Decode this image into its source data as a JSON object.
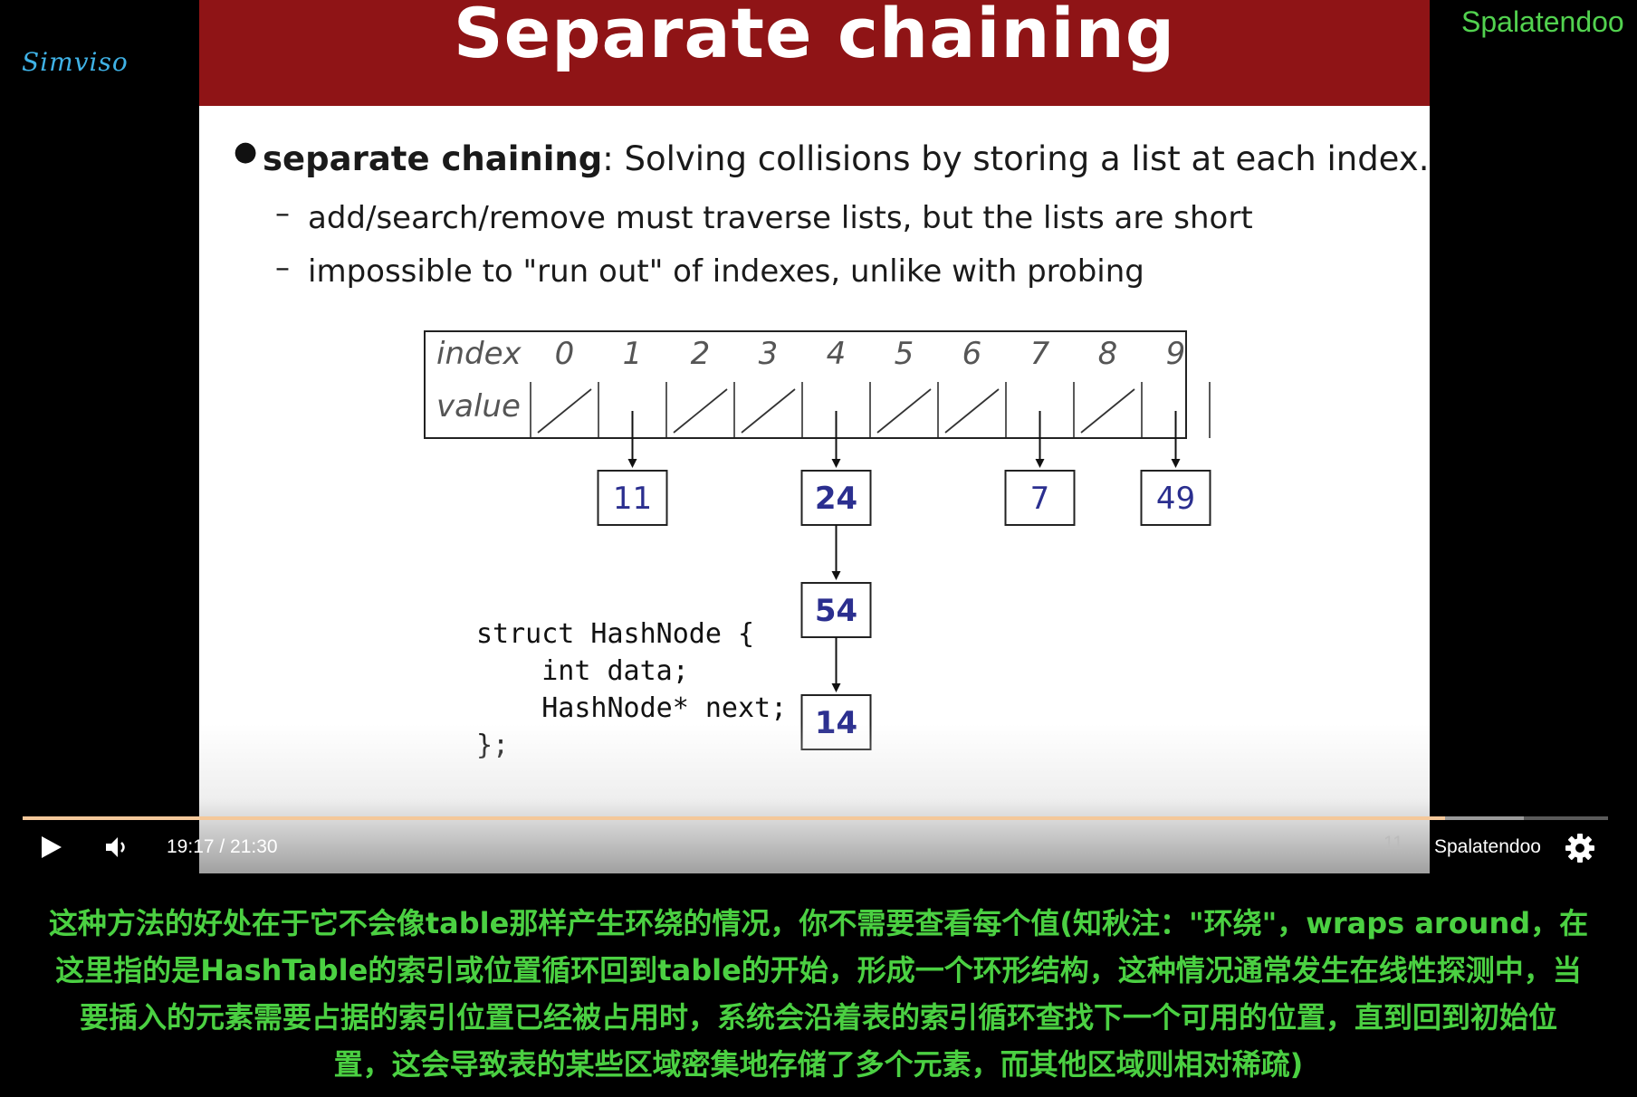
{
  "watermark_logo": "Simviso",
  "channel_top": "Spalatendoo",
  "slide": {
    "title": "Separate chaining",
    "bullet": {
      "term": "separate chaining",
      "rest": ": Solving collisions by storing a list at each index."
    },
    "subbullets": [
      "add/search/remove must traverse lists, but the lists are short",
      "impossible to \"run out\" of indexes, unlike with probing"
    ],
    "table": {
      "index_label": "index",
      "value_label": "value",
      "indexes": [
        "0",
        "1",
        "2",
        "3",
        "4",
        "5",
        "6",
        "7",
        "8",
        "9"
      ],
      "empty_slots": [
        0,
        2,
        3,
        5,
        6,
        8
      ]
    },
    "chains": [
      {
        "index": 1,
        "nodes": [
          "11"
        ]
      },
      {
        "index": 4,
        "nodes": [
          "24",
          "54",
          "14"
        ]
      },
      {
        "index": 7,
        "nodes": [
          "7"
        ]
      },
      {
        "index": 9,
        "nodes": [
          "49"
        ]
      }
    ],
    "code": "struct HashNode {\n    int data;\n    HashNode* next;\n};"
  },
  "player": {
    "time": "19:17 / 21:30",
    "progress_fraction": 0.897,
    "buffered_fraction": 0.947,
    "page_number": "11",
    "channel_name": "Spalatendoo",
    "icons": [
      "play-icon",
      "volume-icon",
      "settings-gear-icon"
    ],
    "accent_color": "#f4c89a"
  },
  "subtitles": [
    "这种方法的好处在于它不会像table那样产生环绕的情况，你不需要查看每个值(知秋注：\"环绕\"，wraps around，在",
    "这里指的是HashTable的索引或位置循环回到table的开始，形成一个环形结构，这种情况通常发生在线性探测中，当",
    "要插入的元素需要占据的索引位置已经被占用时，系统会沿着表的索引循环查找下一个可用的位置，直到回到初始位",
    "置，这会导致表的某些区域密集地存储了多个元素，而其他区域则相对稀疏)"
  ],
  "subtitle_color": "#4bd042"
}
